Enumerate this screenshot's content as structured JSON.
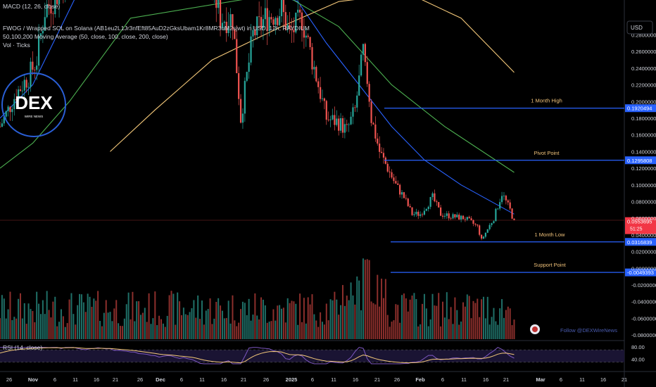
{
  "indicators": {
    "macd": "MACD (12, 26, close)",
    "ma": "50,100,200 Moving Average (50, close, 100, close, 200, close)",
    "vol": "Vol · Ticks",
    "rsi": "RSI (14, close)"
  },
  "symbol_title": "FWOG / Wrapped SOL on Solana (AB1eu2L1Jr3nfEft85AuD2zGksUbam1Kr8MR3uM2sjwt) in USD, 12h, RAYDIUM",
  "currency_button": "USD",
  "watermark": "Follow @DEXWireNews",
  "logo": {
    "text": "DEX",
    "sub": "WIRE NEWS"
  },
  "colors": {
    "up": "#26a69a",
    "down": "#ef5350",
    "ma50": "#2962ff",
    "ma100": "#4caf50",
    "ma200": "#f5c97a",
    "level": "#2962ff",
    "rsi": "#7e57c2",
    "rsi_ma": "#f5c97a",
    "current": "#f23645",
    "bg": "#000000"
  },
  "chart_data": {
    "type": "candlestick",
    "title": "FWOG / Wrapped SOL on Solana (AB1eu2L1Jr3nfEft85AuD2zGksUbam1Kr8MR3uM2sjwt) in USD, 12h, RAYDIUM",
    "y_axis": {
      "ticks": [
        "0.2800000",
        "0.2600000",
        "0.2400000",
        "0.2200000",
        "0.2000000",
        "0.1800000",
        "0.1600000",
        "0.1400000",
        "0.1200000",
        "0.1000000",
        "0.0800000",
        "0.0600000",
        "0.0400000",
        "0.0200000",
        "0.0000000",
        "-0.0200000",
        "-0.0400000",
        "-0.0600000",
        "-0.0800000"
      ],
      "ylim": [
        -0.085,
        0.31
      ],
      "current_price": "0.0553695",
      "countdown": "51:25"
    },
    "x_axis_ticks": [
      "26",
      "Nov",
      "6",
      "11",
      "16",
      "21",
      "26",
      "Dec",
      "6",
      "11",
      "16",
      "21",
      "26",
      "2025",
      "6",
      "11",
      "16",
      "21",
      "26",
      "Feb",
      "6",
      "11",
      "16",
      "21",
      "Mar",
      "6",
      "11",
      "16",
      "21"
    ],
    "levels": [
      {
        "label": "1 Month High",
        "value": 0.1920494,
        "display": "0.1920494",
        "start": "2025-01-23"
      },
      {
        "label": "Pivot Point",
        "value": 0.1295808,
        "display": "0.1295808",
        "start": "2025-01-23"
      },
      {
        "label": "1 Month Low",
        "value": 0.0316839,
        "display": "0.0316839",
        "start": "2025-01-23"
      },
      {
        "label": "Support Point",
        "value": -0.0049393,
        "display": "-0.0049393",
        "start": "2025-01-23"
      }
    ],
    "price_path": [
      [
        "2024-10-24",
        0.17
      ],
      [
        "2024-10-28",
        0.21
      ],
      [
        "2024-10-31",
        0.23
      ],
      [
        "2024-11-02",
        0.25
      ],
      [
        "2024-11-04",
        0.31
      ],
      [
        "2024-11-10",
        0.35
      ],
      [
        "2024-11-20",
        0.4
      ],
      [
        "2024-12-01",
        0.42
      ],
      [
        "2024-12-10",
        0.4
      ],
      [
        "2024-12-15",
        0.34
      ],
      [
        "2024-12-17",
        0.3
      ],
      [
        "2024-12-20",
        0.3
      ],
      [
        "2024-12-22",
        0.18
      ],
      [
        "2024-12-25",
        0.28
      ],
      [
        "2024-12-28",
        0.3
      ],
      [
        "2025-01-01",
        0.31
      ],
      [
        "2025-01-03",
        0.28
      ],
      [
        "2025-01-06",
        0.3
      ],
      [
        "2025-01-08",
        0.26
      ],
      [
        "2025-01-10",
        0.22
      ],
      [
        "2025-01-12",
        0.18
      ],
      [
        "2025-01-15",
        0.175
      ],
      [
        "2025-01-17",
        0.165
      ],
      [
        "2025-01-19",
        0.19
      ],
      [
        "2025-01-21",
        0.26
      ],
      [
        "2025-01-23",
        0.18
      ],
      [
        "2025-01-25",
        0.14
      ],
      [
        "2025-01-27",
        0.12
      ],
      [
        "2025-01-29",
        0.1
      ],
      [
        "2025-01-31",
        0.085
      ],
      [
        "2025-02-02",
        0.065
      ],
      [
        "2025-02-04",
        0.065
      ],
      [
        "2025-02-07",
        0.085
      ],
      [
        "2025-02-09",
        0.065
      ],
      [
        "2025-02-12",
        0.062
      ],
      [
        "2025-02-15",
        0.06
      ],
      [
        "2025-02-18",
        0.05
      ],
      [
        "2025-02-19",
        0.034
      ],
      [
        "2025-02-22",
        0.06
      ],
      [
        "2025-02-24",
        0.09
      ],
      [
        "2025-02-26",
        0.07
      ],
      [
        "2025-02-27",
        0.0554
      ]
    ],
    "ma_series": [
      {
        "name": "MA 50",
        "color": "#2962ff",
        "points": [
          [
            "2024-10-24",
            0.18
          ],
          [
            "2024-11-01",
            0.22
          ],
          [
            "2024-11-06",
            0.27
          ],
          [
            "2024-11-12",
            0.33
          ],
          [
            "2024-12-10",
            0.36
          ],
          [
            "2025-01-05",
            0.32
          ],
          [
            "2025-01-12",
            0.27
          ],
          [
            "2025-01-20",
            0.22
          ],
          [
            "2025-01-28",
            0.17
          ],
          [
            "2025-02-05",
            0.13
          ],
          [
            "2025-02-14",
            0.1
          ],
          [
            "2025-02-27",
            0.065
          ]
        ]
      },
      {
        "name": "MA 100",
        "color": "#4caf50",
        "points": [
          [
            "2024-10-24",
            0.12
          ],
          [
            "2024-11-01",
            0.15
          ],
          [
            "2024-11-10",
            0.2
          ],
          [
            "2024-11-25",
            0.3
          ],
          [
            "2025-01-01",
            0.33
          ],
          [
            "2025-01-15",
            0.29
          ],
          [
            "2025-01-28",
            0.22
          ],
          [
            "2025-02-10",
            0.17
          ],
          [
            "2025-02-27",
            0.115
          ]
        ]
      },
      {
        "name": "MA 200",
        "color": "#f5c97a",
        "points": [
          [
            "2024-11-20",
            0.14
          ],
          [
            "2024-12-01",
            0.19
          ],
          [
            "2024-12-15",
            0.25
          ],
          [
            "2025-01-01",
            0.29
          ],
          [
            "2025-01-15",
            0.32
          ],
          [
            "2025-02-01",
            0.33
          ],
          [
            "2025-02-14",
            0.3
          ],
          [
            "2025-02-27",
            0.235
          ]
        ]
      }
    ],
    "volume": {
      "note": "relative bar heights, 0-1",
      "peak_dates": [
        "2025-01-21",
        "2025-01-22"
      ]
    },
    "rsi": {
      "ticks": [
        "80.00",
        "40.00"
      ],
      "upper": 70,
      "lower": 30
    },
    "x_start": "2024-10-24",
    "x_end": "2025-03-26"
  }
}
